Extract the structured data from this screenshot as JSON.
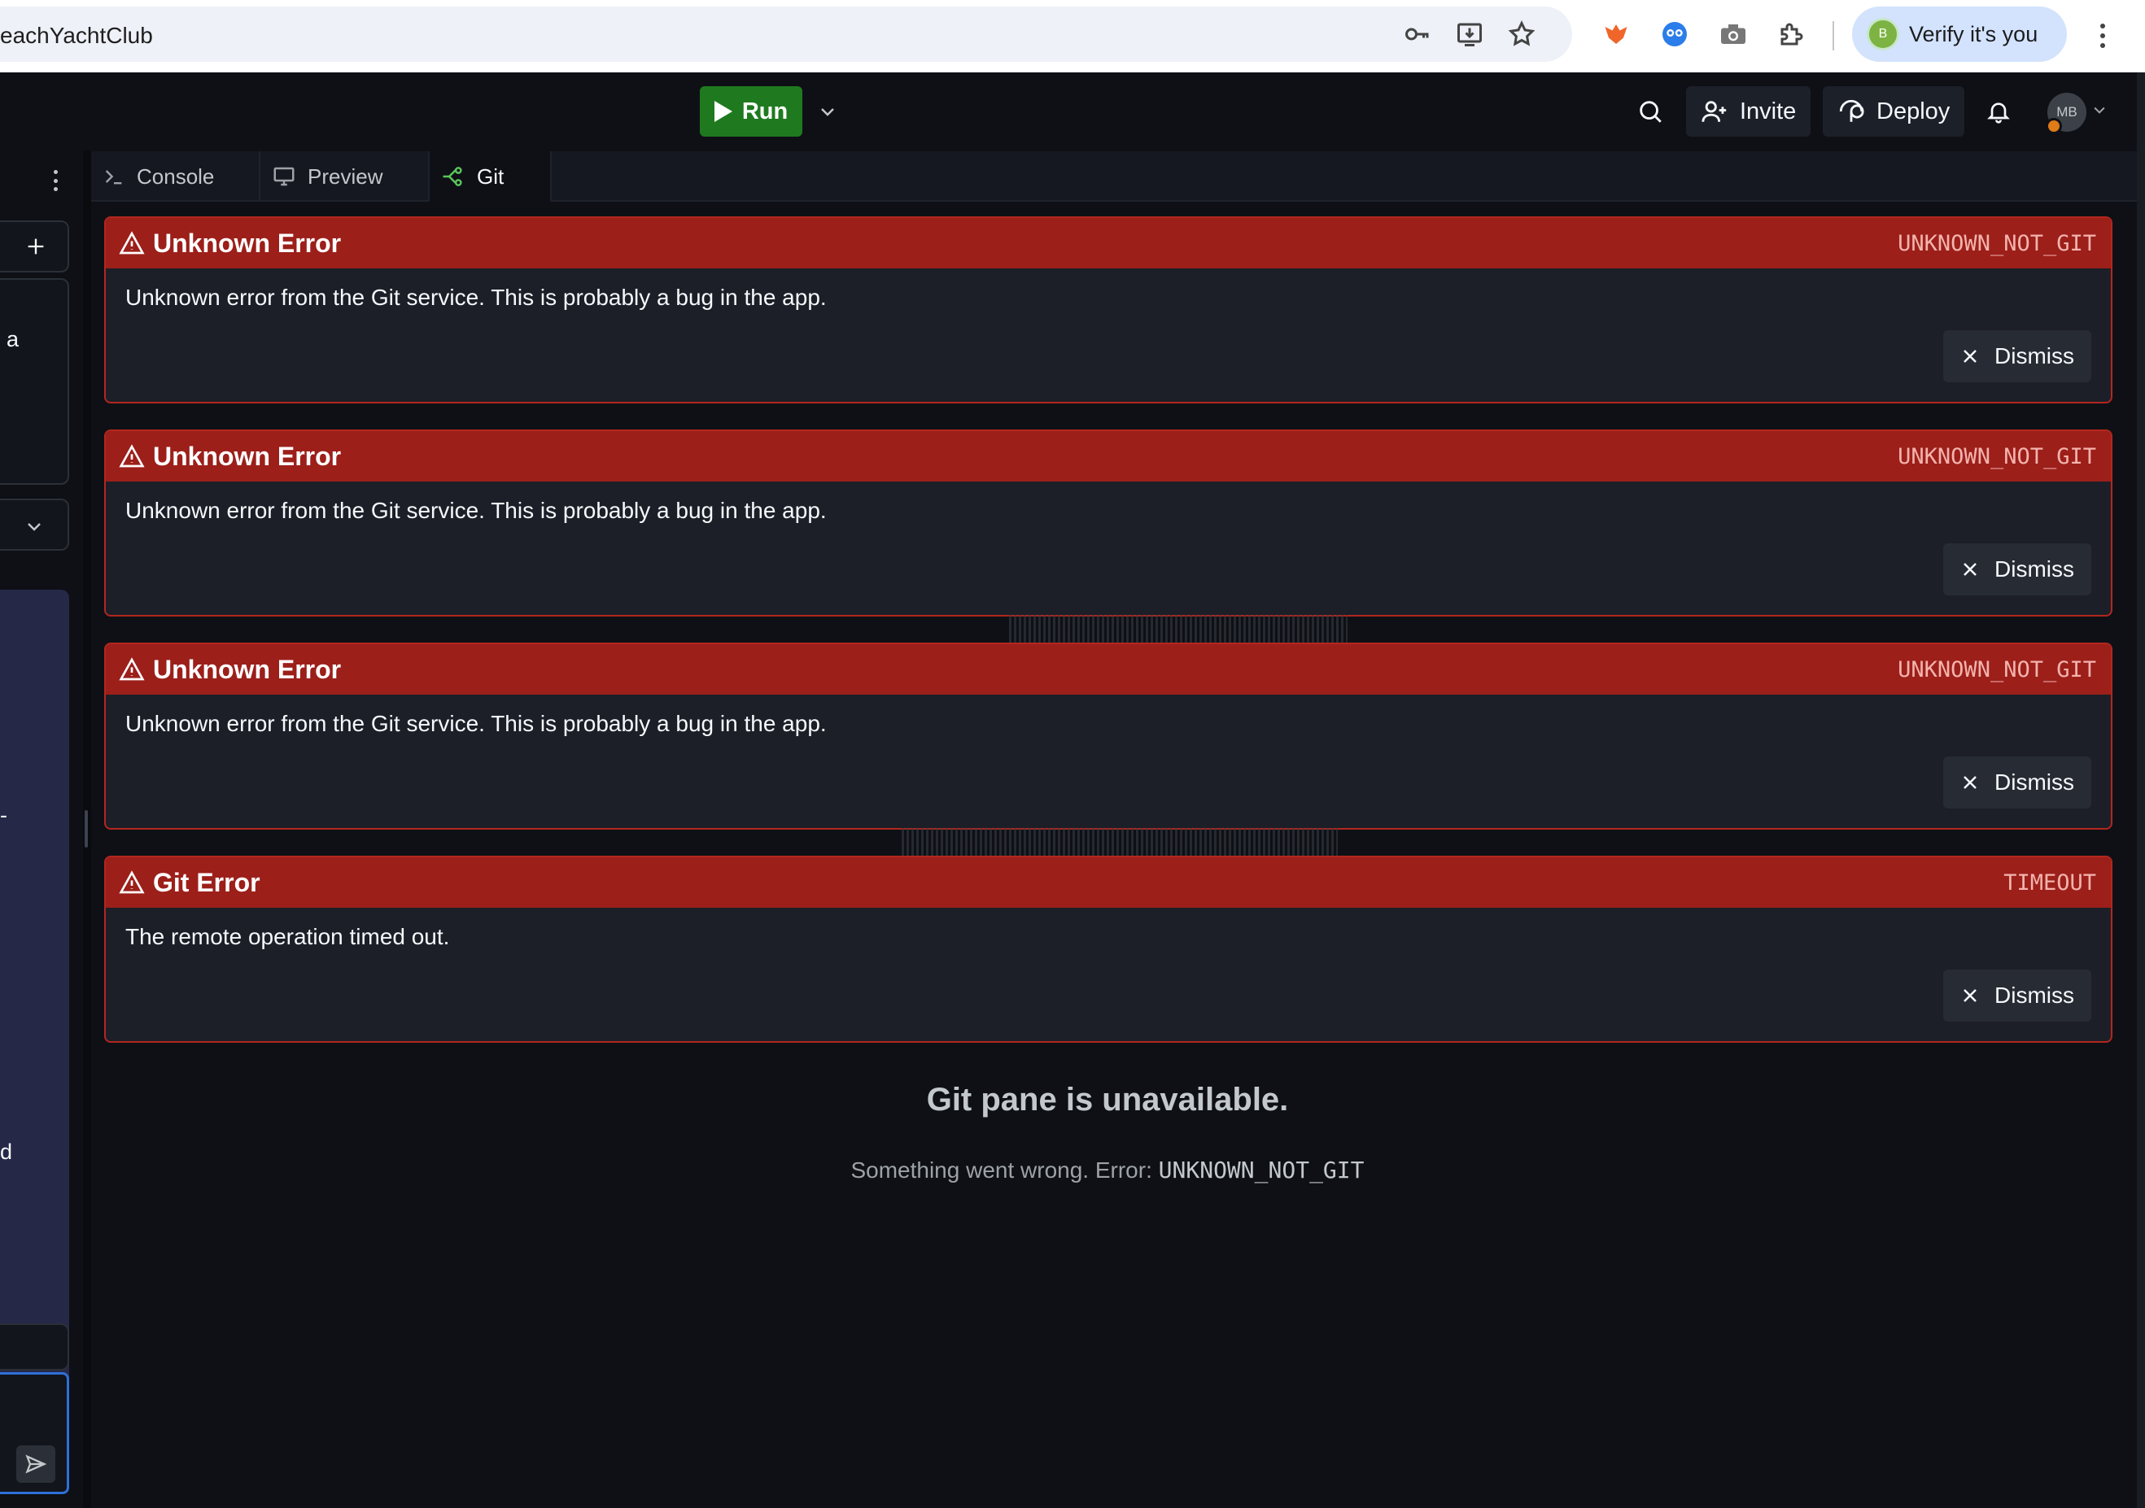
{
  "browser": {
    "url_text": "eachYachtClub",
    "verify_label": "Verify it's you",
    "verify_avatar_letter": "B"
  },
  "topbar": {
    "run_label": "Run",
    "invite_label": "Invite",
    "deploy_label": "Deploy",
    "avatar_initials": "MB",
    "colors": {
      "run": "#1f7a1f",
      "avatar_badge": "#e07b18"
    }
  },
  "sidebar": {
    "snippet_a": "a",
    "snippet_dash": "-",
    "snippet_d": "d"
  },
  "tabs": [
    {
      "label": "Console",
      "icon": "terminal-icon"
    },
    {
      "label": "Preview",
      "icon": "monitor-icon"
    },
    {
      "label": "Git",
      "icon": "git-branch-icon",
      "active": true
    }
  ],
  "errors": [
    {
      "title": "Unknown Error",
      "code": "UNKNOWN_NOT_GIT",
      "message": "Unknown error from the Git service. This is probably a bug in the app.",
      "dismiss_label": "Dismiss"
    },
    {
      "title": "Unknown Error",
      "code": "UNKNOWN_NOT_GIT",
      "message": "Unknown error from the Git service. This is probably a bug in the app.",
      "dismiss_label": "Dismiss"
    },
    {
      "title": "Unknown Error",
      "code": "UNKNOWN_NOT_GIT",
      "message": "Unknown error from the Git service. This is probably a bug in the app.",
      "dismiss_label": "Dismiss"
    },
    {
      "title": "Git Error",
      "code": "TIMEOUT",
      "message": "The remote operation timed out.",
      "dismiss_label": "Dismiss"
    }
  ],
  "git_pane": {
    "title": "Git pane is unavailable.",
    "subtitle_prefix": "Something went wrong. Error: ",
    "subtitle_code": "UNKNOWN_NOT_GIT"
  },
  "colors": {
    "error_header": "#9c1f1a",
    "error_border": "#b3261e",
    "background": "#0e1016"
  }
}
